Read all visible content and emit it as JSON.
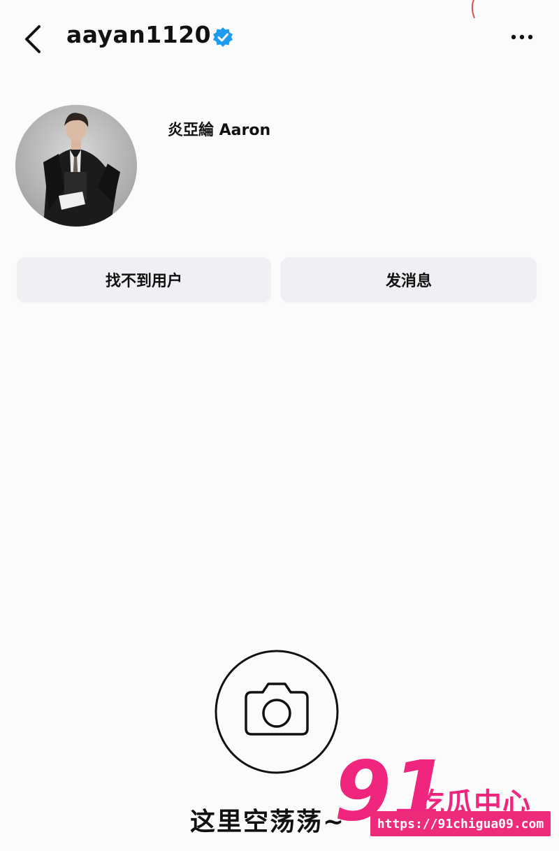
{
  "header": {
    "username": "aayan1120",
    "back_icon": "chevron-left-icon",
    "verified_icon": "verified-badge-icon",
    "more_icon": "more-horizontal-icon"
  },
  "profile": {
    "display_name": "炎亞綸 Aaron"
  },
  "actions": {
    "primary_label": "找不到用户",
    "message_label": "发消息"
  },
  "empty_state": {
    "icon": "camera-icon",
    "text": "这里空荡荡~"
  },
  "watermark": {
    "number": "91",
    "title": "吃瓜中心",
    "url": "https://91chigua09.com",
    "color": "#ee2a7b"
  },
  "colors": {
    "verified_blue": "#1d9bf0",
    "button_bg": "#eef0f3",
    "background": "#fbfbfb"
  }
}
